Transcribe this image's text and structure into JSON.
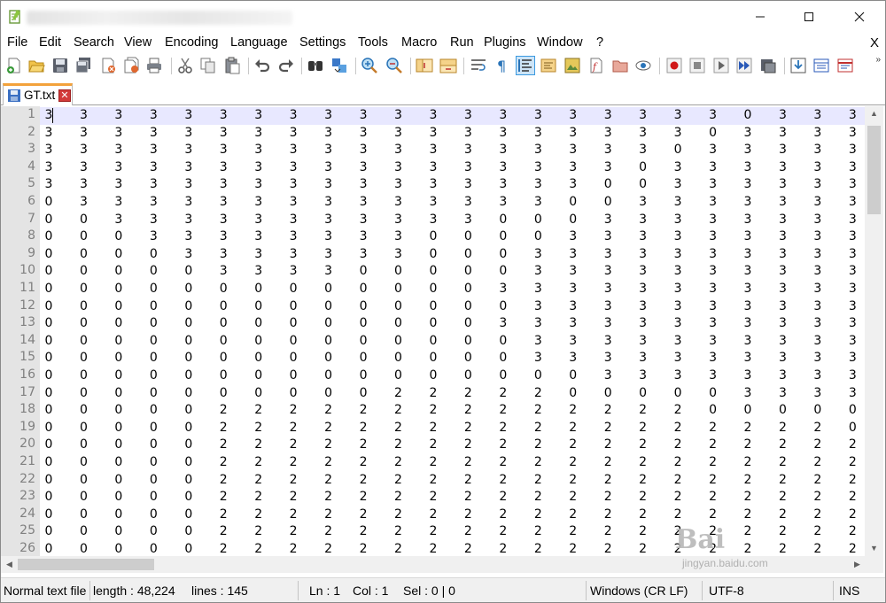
{
  "window": {
    "title": "",
    "minimize_label": "─",
    "maximize_label": "☐",
    "close_label": "✕"
  },
  "menu": {
    "items": [
      "File",
      "Edit",
      "Search",
      "View",
      "Encoding",
      "Language",
      "Settings",
      "Tools",
      "Macro",
      "Run",
      "Plugins",
      "Window",
      "?"
    ],
    "close_doc_label": "X"
  },
  "toolbar": {
    "icons": [
      "new-file-icon",
      "open-file-icon",
      "save-icon",
      "save-all-icon",
      "close-icon",
      "close-all-icon",
      "print-icon",
      "cut-icon",
      "copy-icon",
      "paste-icon",
      "undo-icon",
      "redo-icon",
      "find-icon",
      "replace-icon",
      "zoom-in-icon",
      "zoom-out-icon",
      "sync-vertical-icon",
      "sync-horizontal-icon",
      "word-wrap-icon",
      "show-all-chars-icon",
      "indent-guide-icon",
      "user-lang-icon",
      "doc-map-icon",
      "function-list-icon",
      "folder-workspace-icon",
      "monitoring-icon",
      "record-macro-icon",
      "stop-macro-icon",
      "play-macro-icon",
      "run-macro-multiple-icon",
      "save-macro-icon",
      "plugin-a-icon",
      "plugin-b-icon",
      "plugin-c-icon"
    ],
    "more_label": "»"
  },
  "tabs": [
    {
      "label": "GT.txt",
      "close_label": "✕"
    }
  ],
  "editor": {
    "line_numbers": [
      "1",
      "2",
      "3",
      "4",
      "5",
      "6",
      "7",
      "8",
      "9",
      "10",
      "11",
      "12",
      "13",
      "14",
      "15",
      "16",
      "17",
      "18",
      "19",
      "20",
      "21",
      "22",
      "23",
      "24",
      "25",
      "26"
    ],
    "rows": [
      "3333333333333333333303333",
      "3333333333333333333033333",
      "3333333333333333330333333",
      "3333333333333333303333333",
      "3333333333333333003333333",
      "0333333333333330033333333",
      "0033333333333000333333333",
      "0003333333300003333333333",
      "0000333333300033333333333",
      "0000033330000033333333333",
      "0000000000000333333333333",
      "0000000000000033333333333",
      "0000000000000333333333333",
      "0000000000000033333333333",
      "0000000000000033333333333",
      "0000000000000000333333333",
      "0000000000222220000033333",
      "0000022222222222222000003",
      "0000022222222222222222200",
      "0000022222222222222222220",
      "0000022222222222222222222",
      "0000022222222222222222222",
      "0000022222222222222222222",
      "0000022222222222222222222",
      "0000022222222222222222222",
      "0000022222222222222222222"
    ]
  },
  "status": {
    "file_type": "Normal text file",
    "length": "length : 48,224",
    "lines": "lines : 145",
    "ln": "Ln : 1",
    "col": "Col : 1",
    "sel": "Sel : 0 | 0",
    "eol": "Windows (CR LF)",
    "encoding": "UTF-8",
    "mode": "INS"
  },
  "watermark": {
    "text": "Bai",
    "sub": "jingyan.baidu.com"
  }
}
